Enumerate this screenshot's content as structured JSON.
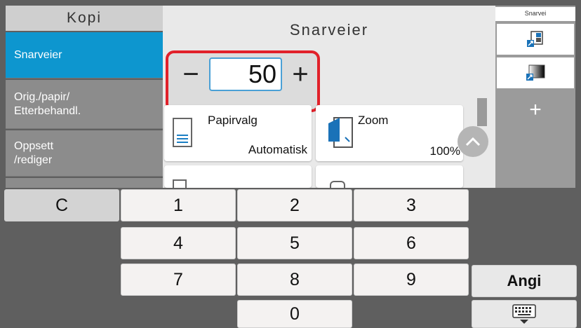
{
  "sidebar": {
    "title": "Kopi",
    "items": [
      {
        "label": "Snarveier",
        "active": true
      },
      {
        "label": "Orig./papir/\nEtterbehandl.",
        "active": false
      },
      {
        "label": "Oppsett\n/rediger",
        "active": false
      }
    ]
  },
  "main": {
    "title": "Snarveier",
    "stepper": {
      "minus": "−",
      "value": "50",
      "plus": "+"
    },
    "functions": [
      {
        "label": "Papirvalg",
        "value": "Automatisk",
        "icon": "paper-tray-icon"
      },
      {
        "label": "Zoom",
        "value": "100%",
        "icon": "zoom-icon"
      }
    ]
  },
  "shortcuts": {
    "header": "Snarvei",
    "add_label": "+"
  },
  "keypad": {
    "clear": "C",
    "digits": [
      "1",
      "2",
      "3",
      "4",
      "5",
      "6",
      "7",
      "8",
      "9",
      "0"
    ],
    "enter": "Angi",
    "keyboard_icon": "keyboard-icon"
  },
  "colors": {
    "accent": "#0d96cf",
    "highlight_frame": "#e1212a"
  }
}
